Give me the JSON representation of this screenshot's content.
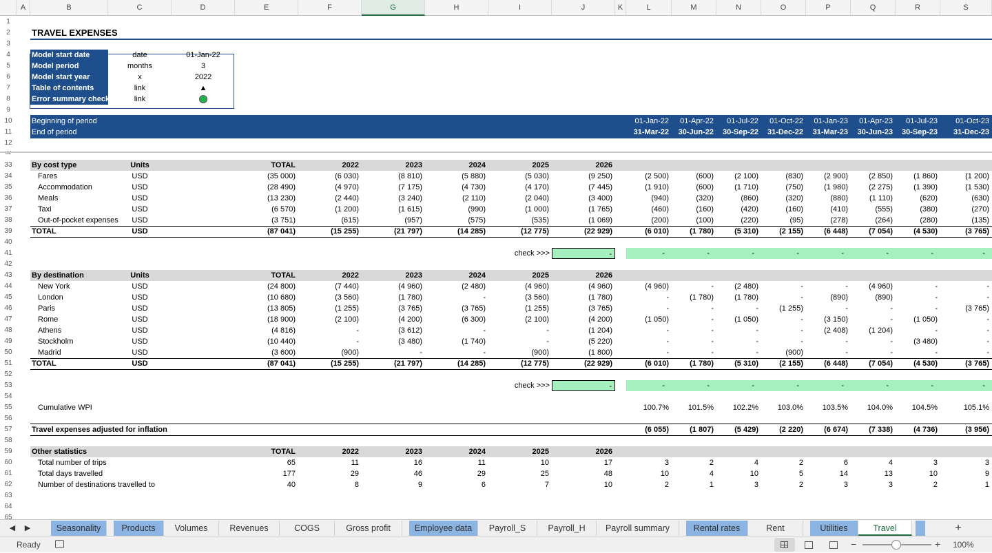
{
  "columns": [
    "A",
    "B",
    "C",
    "D",
    "E",
    "F",
    "G",
    "H",
    "I",
    "J",
    "K",
    "L",
    "M",
    "N",
    "O",
    "P",
    "Q",
    "R",
    "S"
  ],
  "selected_column": "G",
  "title": "TRAVEL EXPENSES",
  "info": [
    {
      "label": "Model start date",
      "unit": "date",
      "value": "01-Jan-22"
    },
    {
      "label": "Model period",
      "unit": "months",
      "value": "3"
    },
    {
      "label": "Model start year",
      "unit": "x",
      "value": "2022"
    },
    {
      "label": "Table of contents",
      "unit": "link",
      "value": "▲"
    },
    {
      "label": "Error summary check",
      "unit": "link",
      "value": ""
    }
  ],
  "period_header": {
    "begin_label": "Beginning of period",
    "end_label": "End of period",
    "begin": [
      "01-Jan-22",
      "01-Apr-22",
      "01-Jul-22",
      "01-Oct-22",
      "01-Jan-23",
      "01-Apr-23",
      "01-Jul-23",
      "01-Oct-23"
    ],
    "end": [
      "31-Mar-22",
      "30-Jun-22",
      "30-Sep-22",
      "31-Dec-22",
      "31-Mar-23",
      "30-Jun-23",
      "30-Sep-23",
      "31-Dec-23"
    ]
  },
  "cost_header": [
    "By cost type",
    "Units",
    "TOTAL",
    "2022",
    "2023",
    "2024",
    "2025",
    "2026"
  ],
  "cost_rows": [
    {
      "label": "Fares",
      "unit": "USD",
      "v": [
        "(35 000)",
        "(6 030)",
        "(8 810)",
        "(5 880)",
        "(5 030)",
        "(9 250)"
      ],
      "q": [
        "(2 500)",
        "(600)",
        "(2 100)",
        "(830)",
        "(2 900)",
        "(2 850)",
        "(1 860)",
        "(1 200)"
      ]
    },
    {
      "label": "Accommodation",
      "unit": "USD",
      "v": [
        "(28 490)",
        "(4 970)",
        "(7 175)",
        "(4 730)",
        "(4 170)",
        "(7 445)"
      ],
      "q": [
        "(1 910)",
        "(600)",
        "(1 710)",
        "(750)",
        "(1 980)",
        "(2 275)",
        "(1 390)",
        "(1 530)"
      ]
    },
    {
      "label": "Meals",
      "unit": "USD",
      "v": [
        "(13 230)",
        "(2 440)",
        "(3 240)",
        "(2 110)",
        "(2 040)",
        "(3 400)"
      ],
      "q": [
        "(940)",
        "(320)",
        "(860)",
        "(320)",
        "(880)",
        "(1 110)",
        "(620)",
        "(630)"
      ]
    },
    {
      "label": "Taxi",
      "unit": "USD",
      "v": [
        "(6 570)",
        "(1 200)",
        "(1 615)",
        "(990)",
        "(1 000)",
        "(1 765)"
      ],
      "q": [
        "(460)",
        "(160)",
        "(420)",
        "(160)",
        "(410)",
        "(555)",
        "(380)",
        "(270)"
      ]
    },
    {
      "label": "Out-of-pocket expenses",
      "unit": "USD",
      "v": [
        "(3 751)",
        "(615)",
        "(957)",
        "(575)",
        "(535)",
        "(1 069)"
      ],
      "q": [
        "(200)",
        "(100)",
        "(220)",
        "(95)",
        "(278)",
        "(264)",
        "(280)",
        "(135)"
      ]
    }
  ],
  "cost_total": {
    "label": "TOTAL",
    "unit": "USD",
    "v": [
      "(87 041)",
      "(15 255)",
      "(21 797)",
      "(14 285)",
      "(12 775)",
      "(22 929)"
    ],
    "q": [
      "(6 010)",
      "(1 780)",
      "(5 310)",
      "(2 155)",
      "(6 448)",
      "(7 054)",
      "(4 530)",
      "(3 765)"
    ]
  },
  "check_label": "check >>>",
  "check_value": "-",
  "check_q": [
    "-",
    "-",
    "-",
    "-",
    "-",
    "-",
    "-",
    "-"
  ],
  "dest_header": [
    "By destination",
    "Units",
    "TOTAL",
    "2022",
    "2023",
    "2024",
    "2025",
    "2026"
  ],
  "dest_rows": [
    {
      "label": "New York",
      "unit": "USD",
      "v": [
        "(24 800)",
        "(7 440)",
        "(4 960)",
        "(2 480)",
        "(4 960)",
        "(4 960)"
      ],
      "q": [
        "(4 960)",
        "-",
        "(2 480)",
        "-",
        "-",
        "(4 960)",
        "-",
        "-"
      ]
    },
    {
      "label": "London",
      "unit": "USD",
      "v": [
        "(10 680)",
        "(3 560)",
        "(1 780)",
        "-",
        "(3 560)",
        "(1 780)"
      ],
      "q": [
        "-",
        "(1 780)",
        "(1 780)",
        "-",
        "(890)",
        "(890)",
        "-",
        "-"
      ]
    },
    {
      "label": "Paris",
      "unit": "USD",
      "v": [
        "(13 805)",
        "(1 255)",
        "(3 765)",
        "(3 765)",
        "(1 255)",
        "(3 765)"
      ],
      "q": [
        "-",
        "-",
        "-",
        "(1 255)",
        "-",
        "-",
        "-",
        "(3 765)"
      ]
    },
    {
      "label": "Rome",
      "unit": "USD",
      "v": [
        "(18 900)",
        "(2 100)",
        "(4 200)",
        "(6 300)",
        "(2 100)",
        "(4 200)"
      ],
      "q": [
        "(1 050)",
        "-",
        "(1 050)",
        "-",
        "(3 150)",
        "-",
        "(1 050)",
        "-"
      ]
    },
    {
      "label": "Athens",
      "unit": "USD",
      "v": [
        "(4 816)",
        "-",
        "(3 612)",
        "-",
        "-",
        "(1 204)"
      ],
      "q": [
        "-",
        "-",
        "-",
        "-",
        "(2 408)",
        "(1 204)",
        "-",
        "-"
      ]
    },
    {
      "label": "Stockholm",
      "unit": "USD",
      "v": [
        "(10 440)",
        "-",
        "(3 480)",
        "(1 740)",
        "-",
        "(5 220)"
      ],
      "q": [
        "-",
        "-",
        "-",
        "-",
        "-",
        "-",
        "(3 480)",
        "-"
      ]
    },
    {
      "label": "Madrid",
      "unit": "USD",
      "v": [
        "(3 600)",
        "(900)",
        "-",
        "-",
        "(900)",
        "(1 800)"
      ],
      "q": [
        "-",
        "-",
        "-",
        "(900)",
        "-",
        "-",
        "-",
        "-"
      ]
    }
  ],
  "dest_total": {
    "label": "TOTAL",
    "unit": "USD",
    "v": [
      "(87 041)",
      "(15 255)",
      "(21 797)",
      "(14 285)",
      "(12 775)",
      "(22 929)"
    ],
    "q": [
      "(6 010)",
      "(1 780)",
      "(5 310)",
      "(2 155)",
      "(6 448)",
      "(7 054)",
      "(4 530)",
      "(3 765)"
    ]
  },
  "wpi": {
    "label": "Cumulative WPI",
    "q": [
      "100.7%",
      "101.5%",
      "102.2%",
      "103.0%",
      "103.5%",
      "104.0%",
      "104.5%",
      "105.1%"
    ]
  },
  "adjusted": {
    "label": "Travel expenses adjusted for inflation",
    "q": [
      "(6 055)",
      "(1 807)",
      "(5 429)",
      "(2 220)",
      "(6 674)",
      "(7 338)",
      "(4 736)",
      "(3 956)"
    ]
  },
  "stats_header": [
    "Other statistics",
    "",
    "TOTAL",
    "2022",
    "2023",
    "2024",
    "2025",
    "2026"
  ],
  "stats_rows": [
    {
      "label": "Total number of trips",
      "v": [
        "65",
        "11",
        "16",
        "11",
        "10",
        "17"
      ],
      "q": [
        "3",
        "2",
        "4",
        "2",
        "6",
        "4",
        "3",
        "3"
      ]
    },
    {
      "label": "Total days travelled",
      "v": [
        "177",
        "29",
        "46",
        "29",
        "25",
        "48"
      ],
      "q": [
        "10",
        "4",
        "10",
        "5",
        "14",
        "13",
        "10",
        "9"
      ]
    },
    {
      "label": "Number of destinations travelled to",
      "v": [
        "40",
        "8",
        "9",
        "6",
        "7",
        "10"
      ],
      "q": [
        "2",
        "1",
        "3",
        "2",
        "3",
        "3",
        "2",
        "1"
      ]
    }
  ],
  "row_numbers": [
    "1",
    "2",
    "3",
    "4",
    "5",
    "6",
    "7",
    "8",
    "9",
    "10",
    "11",
    "12",
    "32",
    "33",
    "34",
    "35",
    "36",
    "37",
    "38",
    "39",
    "40",
    "41",
    "42",
    "43",
    "44",
    "45",
    "46",
    "47",
    "48",
    "49",
    "50",
    "51",
    "52",
    "53",
    "54",
    "55",
    "56",
    "57",
    "58",
    "59",
    "60",
    "61",
    "62",
    "63",
    "64",
    "65"
  ],
  "tabs": [
    {
      "label": "Seasonality",
      "style": "blue"
    },
    {
      "label": "Products",
      "style": "blue"
    },
    {
      "label": "Volumes",
      "style": "plain"
    },
    {
      "label": "Revenues",
      "style": "plain"
    },
    {
      "label": "COGS",
      "style": "plain"
    },
    {
      "label": "Gross profit",
      "style": "plain"
    },
    {
      "label": "Employee data",
      "style": "blue"
    },
    {
      "label": "Payroll_S",
      "style": "plain"
    },
    {
      "label": "Payroll_H",
      "style": "plain"
    },
    {
      "label": "Payroll summary",
      "style": "plain"
    },
    {
      "label": "Rental rates",
      "style": "blue"
    },
    {
      "label": "Rent",
      "style": "plain"
    },
    {
      "label": "Utilities",
      "style": "blue"
    },
    {
      "label": "Travel",
      "style": "active"
    }
  ],
  "add_sheet": "+",
  "status_text": "Ready",
  "zoom": "100%",
  "colors": {
    "header_blue": "#1f4e8c",
    "band_gray": "#d9d9d9",
    "check_green": "#a6f0bf",
    "tab_blue": "#8cb4e2",
    "excel_green": "#1d6b3f"
  }
}
